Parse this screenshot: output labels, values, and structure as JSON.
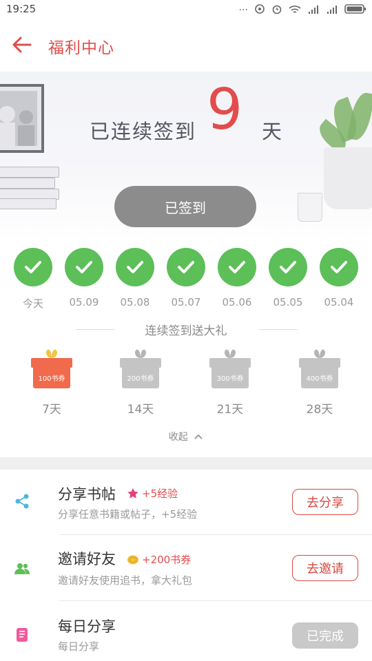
{
  "status_bar": {
    "time": "19:25"
  },
  "header": {
    "title": "福利中心"
  },
  "banner": {
    "streak_prefix": "已连续签到",
    "streak_days": "9",
    "streak_suffix": "天",
    "signed_button": "已签到"
  },
  "checkin_days": [
    {
      "label": "今天",
      "checked": true
    },
    {
      "label": "05.09",
      "checked": true
    },
    {
      "label": "05.08",
      "checked": true
    },
    {
      "label": "05.07",
      "checked": true
    },
    {
      "label": "05.06",
      "checked": true
    },
    {
      "label": "05.05",
      "checked": true
    },
    {
      "label": "05.04",
      "checked": true
    }
  ],
  "gifts": {
    "title": "连续签到送大礼",
    "items": [
      {
        "coupon": "100书券",
        "days": "7天",
        "active": true
      },
      {
        "coupon": "200书券",
        "days": "14天",
        "active": false
      },
      {
        "coupon": "300书券",
        "days": "21天",
        "active": false
      },
      {
        "coupon": "400书券",
        "days": "28天",
        "active": false
      }
    ],
    "collapse_label": "收起"
  },
  "tasks": [
    {
      "title": "分享书帖",
      "reward": "+5经验",
      "desc": "分享任意书籍或帖子，+5经验",
      "button": "去分享",
      "icon": "share-icon"
    },
    {
      "title": "邀请好友",
      "reward": "+200书券",
      "desc": "邀请好友使用追书，拿大礼包",
      "button": "去邀请",
      "icon": "people-icon"
    },
    {
      "title": "每日分享",
      "reward": "",
      "desc": "每日分享",
      "button": "已完成",
      "icon": "book-icon"
    }
  ],
  "colors": {
    "accent": "#e14c4c",
    "check_green": "#5cbf58",
    "gift_active": "#f06a4b",
    "gift_inactive": "#c4c4c4"
  }
}
